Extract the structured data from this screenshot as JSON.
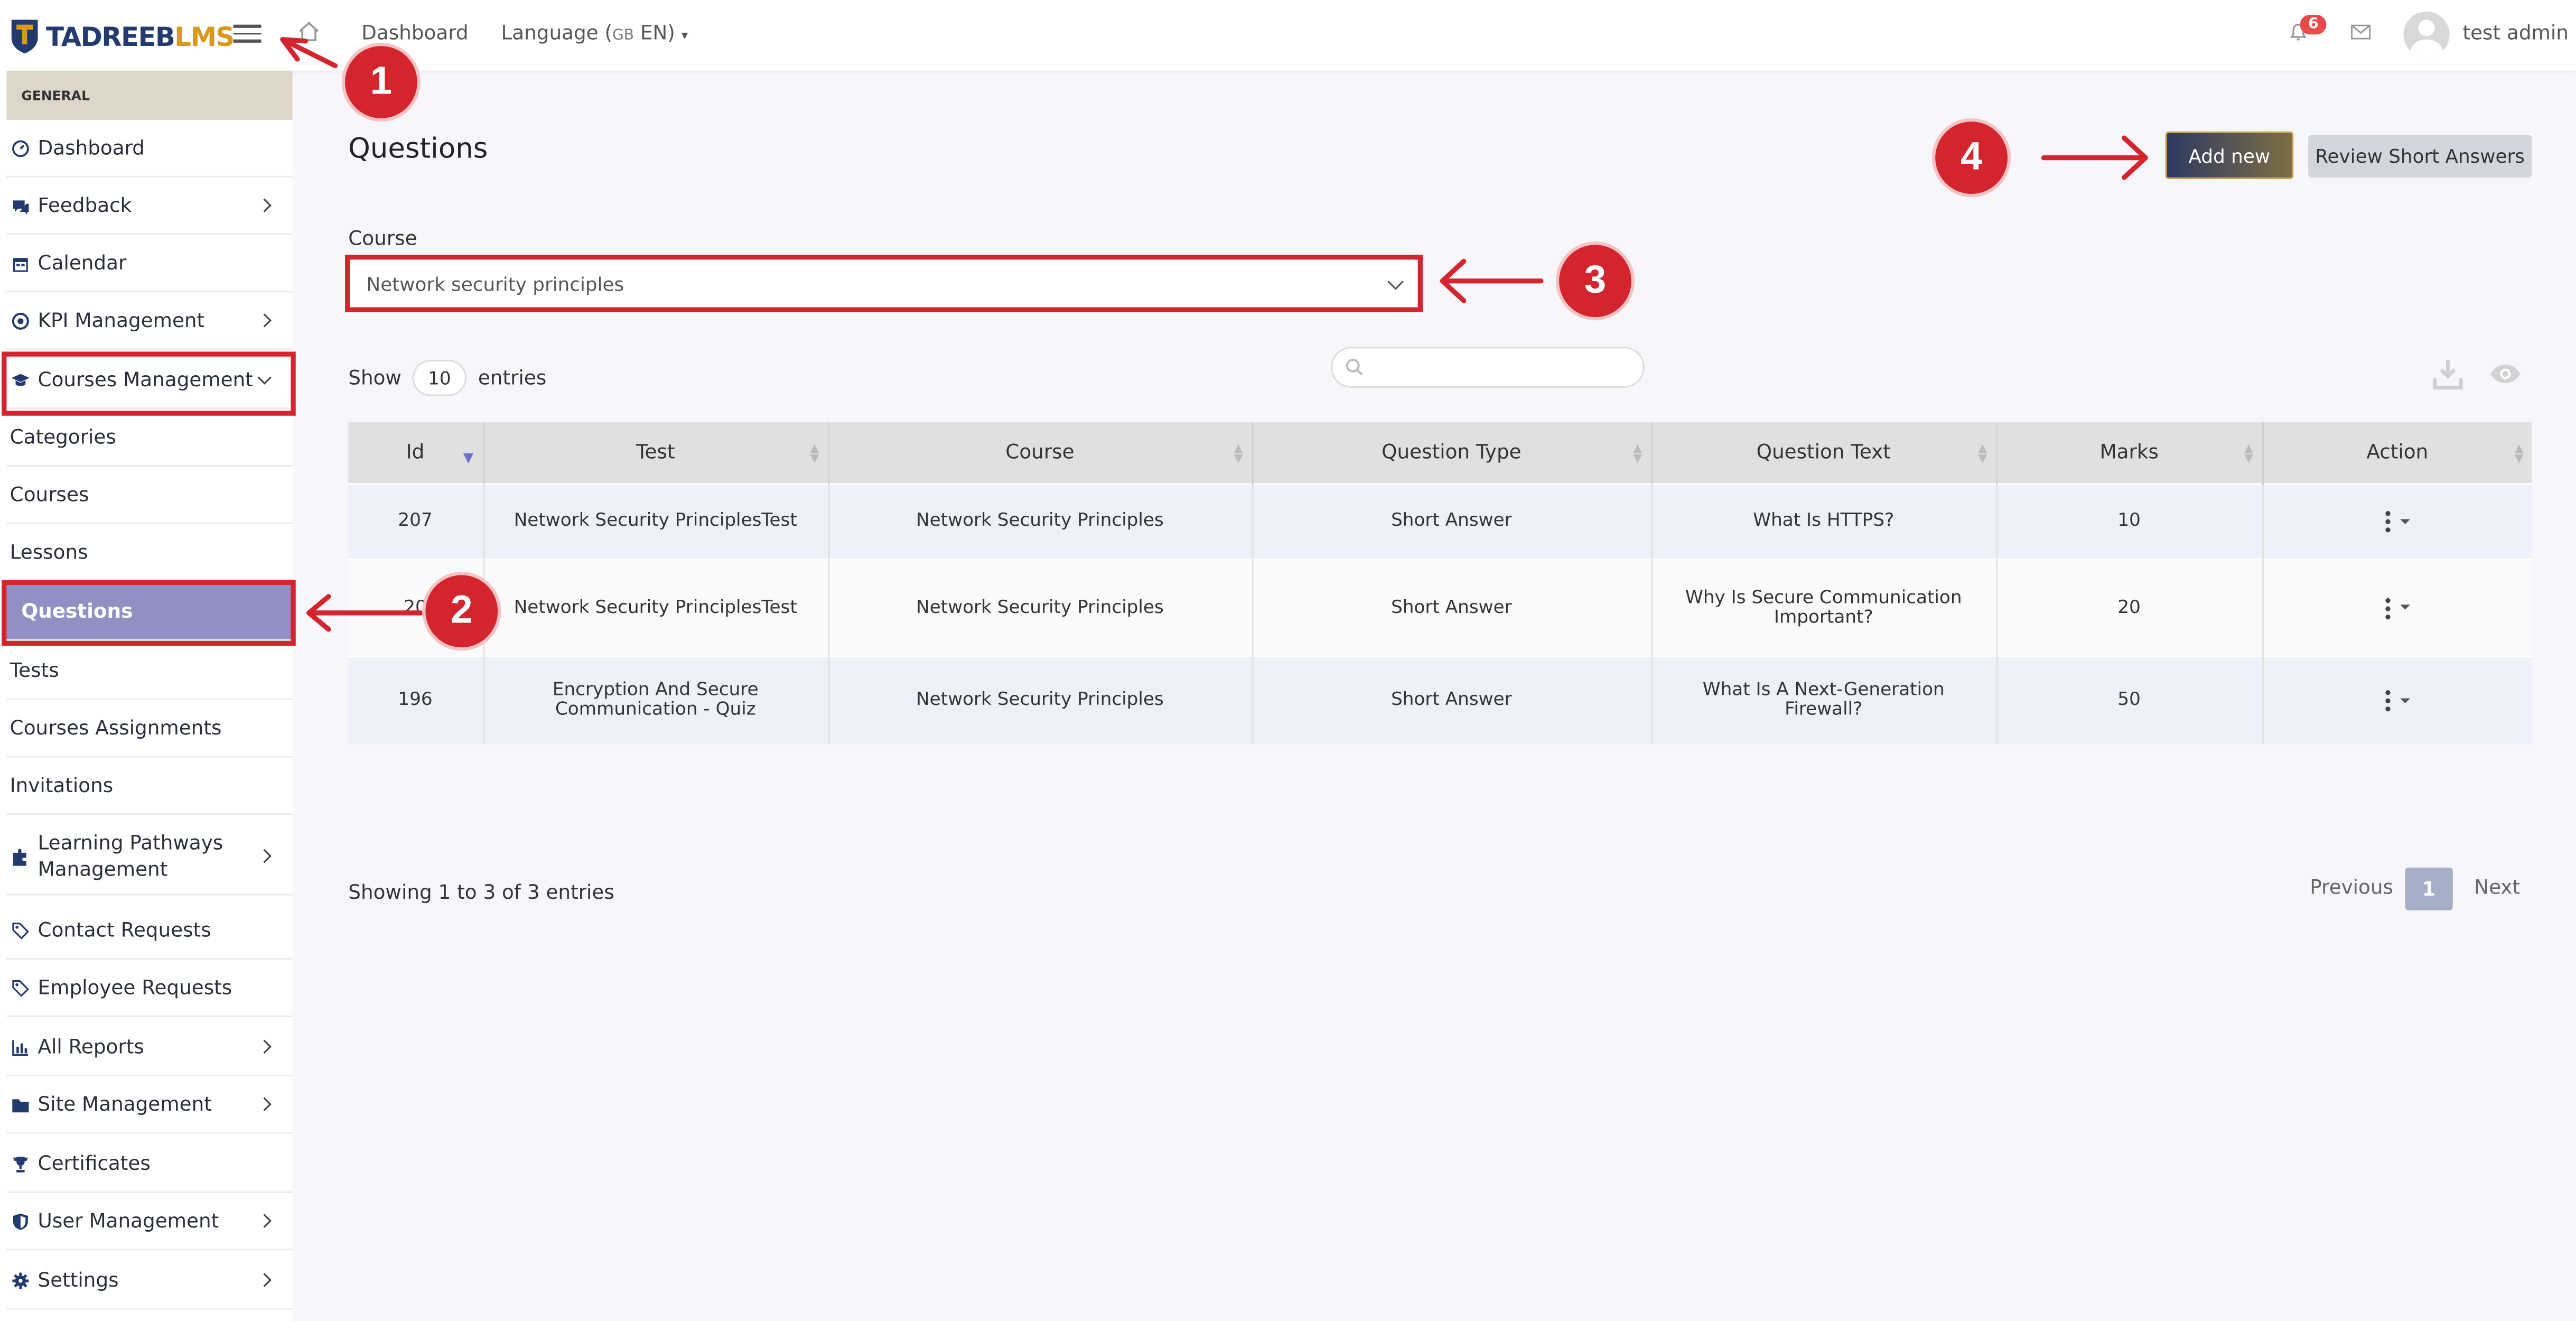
{
  "app": {
    "logo_text_a": "TADREEB",
    "logo_text_b": "LMS",
    "accent_color": "#d4252e",
    "sidebar_active_color": "#8f91c4"
  },
  "topbar": {
    "dashboard_link": "Dashboard",
    "language_label": "Language (",
    "language_flag": "GB",
    "language_code": " EN)",
    "notification_count": "6",
    "user_name": "test admin"
  },
  "sidebar": {
    "section_label": "GENERAL",
    "items": [
      {
        "label": "Dashboard",
        "icon": "gauge-icon"
      },
      {
        "label": "Feedback",
        "icon": "chat-icon"
      },
      {
        "label": "Calendar",
        "icon": "calendar-icon"
      },
      {
        "label": "KPI Management",
        "icon": "target-icon"
      },
      {
        "label": "Courses Management",
        "icon": "graduation-cap-icon"
      },
      {
        "label": "Categories"
      },
      {
        "label": "Courses"
      },
      {
        "label": "Lessons"
      },
      {
        "label": "Questions"
      },
      {
        "label": "Tests"
      },
      {
        "label": "Courses Assignments"
      },
      {
        "label": "Invitations"
      },
      {
        "label": "Learning Pathways Management",
        "icon": "puzzle-icon"
      },
      {
        "label": "Contact Requests",
        "icon": "tag-icon"
      },
      {
        "label": "Employee Requests",
        "icon": "tag-icon"
      },
      {
        "label": "All Reports",
        "icon": "bar-chart-icon"
      },
      {
        "label": "Site Management",
        "icon": "folder-icon"
      },
      {
        "label": "Certificates",
        "icon": "trophy-icon"
      },
      {
        "label": "User Management",
        "icon": "shield-icon"
      },
      {
        "label": "Settings",
        "icon": "gear-icon"
      }
    ]
  },
  "main": {
    "title": "Questions",
    "add_button": "Add new",
    "review_button": "Review Short Answers",
    "course_label": "Course",
    "course_selected": "Network security principles",
    "show_label": "Show",
    "entries_value": "10",
    "entries_label": "entries",
    "search_placeholder": "",
    "table": {
      "headers": [
        "Id",
        "Test",
        "Course",
        "Question Type",
        "Question Text",
        "Marks",
        "Action"
      ],
      "rows": [
        {
          "id": "207",
          "test": "Network Security PrinciplesTest",
          "course": "Network Security Principles",
          "type": "Short Answer",
          "text": "What Is HTTPS?",
          "marks": "10"
        },
        {
          "id": "20",
          "test": "Network Security PrinciplesTest",
          "course": "Network Security Principles",
          "type": "Short Answer",
          "text": "Why Is Secure Communication Important?",
          "marks": "20"
        },
        {
          "id": "196",
          "test": "Encryption And Secure Communication - Quiz",
          "course": "Network Security Principles",
          "type": "Short Answer",
          "text": "What Is A Next-Generation Firewall?",
          "marks": "50"
        }
      ]
    },
    "showing_text": "Showing 1 to 3 of 3 entries",
    "pagination": {
      "prev": "Previous",
      "current": "1",
      "next": "Next"
    }
  },
  "callouts": [
    "1",
    "2",
    "3",
    "4"
  ]
}
